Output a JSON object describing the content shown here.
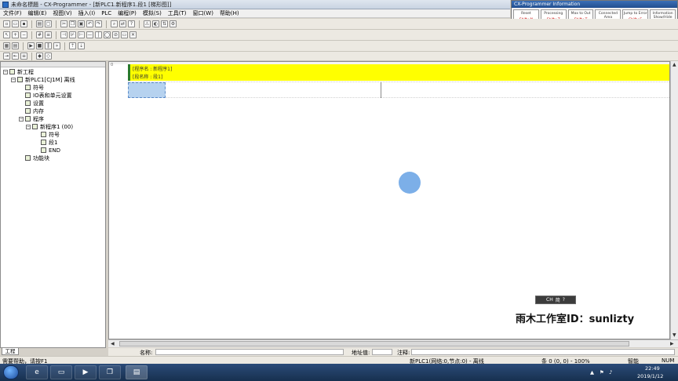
{
  "window": {
    "title": "未命名標題 - CX-Programmer - [新PLC1.新程序1.段1 [梯形图]]"
  },
  "menu": [
    "文件(F)",
    "编辑(E)",
    "视图(V)",
    "插入(I)",
    "PLC",
    "编程(P)",
    "模拟(S)",
    "工具(T)",
    "窗口(W)",
    "帮助(H)"
  ],
  "info_panel": {
    "title": "CX-Programmer Information",
    "cells": [
      {
        "name": "Reset",
        "key": "Shift+N"
      },
      {
        "name": "Processing",
        "key": "Shift+Z"
      },
      {
        "name": "Max to Out",
        "key": "Shift+T"
      },
      {
        "name": "Connected Area",
        "key": "Shift+R"
      },
      {
        "name": "Jump to Error",
        "key": "Shift+E"
      },
      {
        "name": "Information Show/Hide",
        "key": "Ctrl+Shift+I"
      }
    ]
  },
  "tree": {
    "root": "新工程",
    "plc": "新PLC1[CJ1M] 离线",
    "symbols": "符号",
    "io_table": "IO表和单元设置",
    "settings": "设置",
    "memory": "内存",
    "programs": "程序",
    "program1": "新程序1 (00)",
    "prog_symbols": "符号",
    "section1": "段1",
    "end": "END",
    "function_blocks": "功能块"
  },
  "left_tab": "工程",
  "editor": {
    "row_number": "0",
    "program_name_label": "[程序名 : 新程序1]",
    "section_name_label": "[段名称 : 段1]"
  },
  "name_bar": {
    "name_label": "名称:",
    "address_label": "地址值:",
    "comment_label": "注释:"
  },
  "status": {
    "help_text": "需要帮助，请按F1",
    "plc_status": "新PLC1(网络:0,节点:0) - 离线",
    "position": "条 0 (0, 0)  - 100%",
    "mode": "智能",
    "num": "NUM"
  },
  "ime": {
    "label": "CH",
    "mode": "简"
  },
  "watermark": "雨木工作室ID：sunlizty",
  "taskbar": {
    "time": "22:49",
    "date": "2019/1/12"
  }
}
